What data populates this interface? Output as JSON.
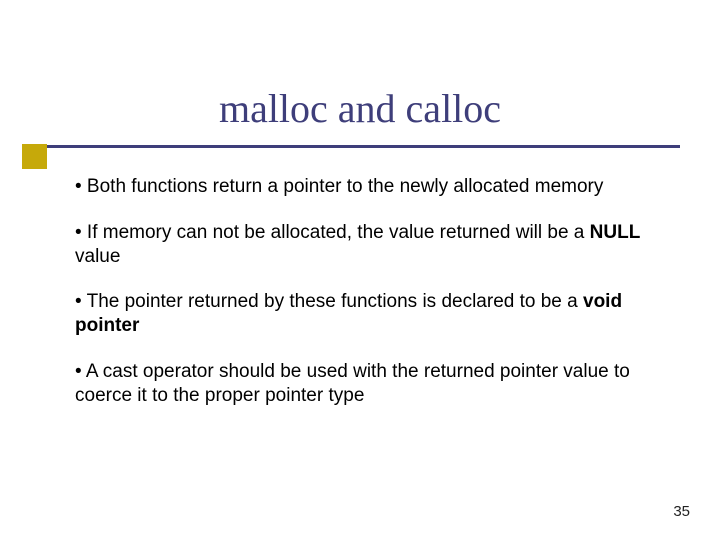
{
  "title": "malloc and calloc",
  "bullets": [
    {
      "pre": "• Both functions return a pointer to the newly allocated memory"
    },
    {
      "pre": "• If memory can not be allocated, the value returned will be a ",
      "bold": "NULL",
      "post": " value"
    },
    {
      "pre": "• The pointer returned by these functions is declared to be a ",
      "bold": "void pointer"
    },
    {
      "pre": "• A cast operator should be used with the returned pointer value to coerce it to the proper pointer type"
    }
  ],
  "page_number": "35"
}
